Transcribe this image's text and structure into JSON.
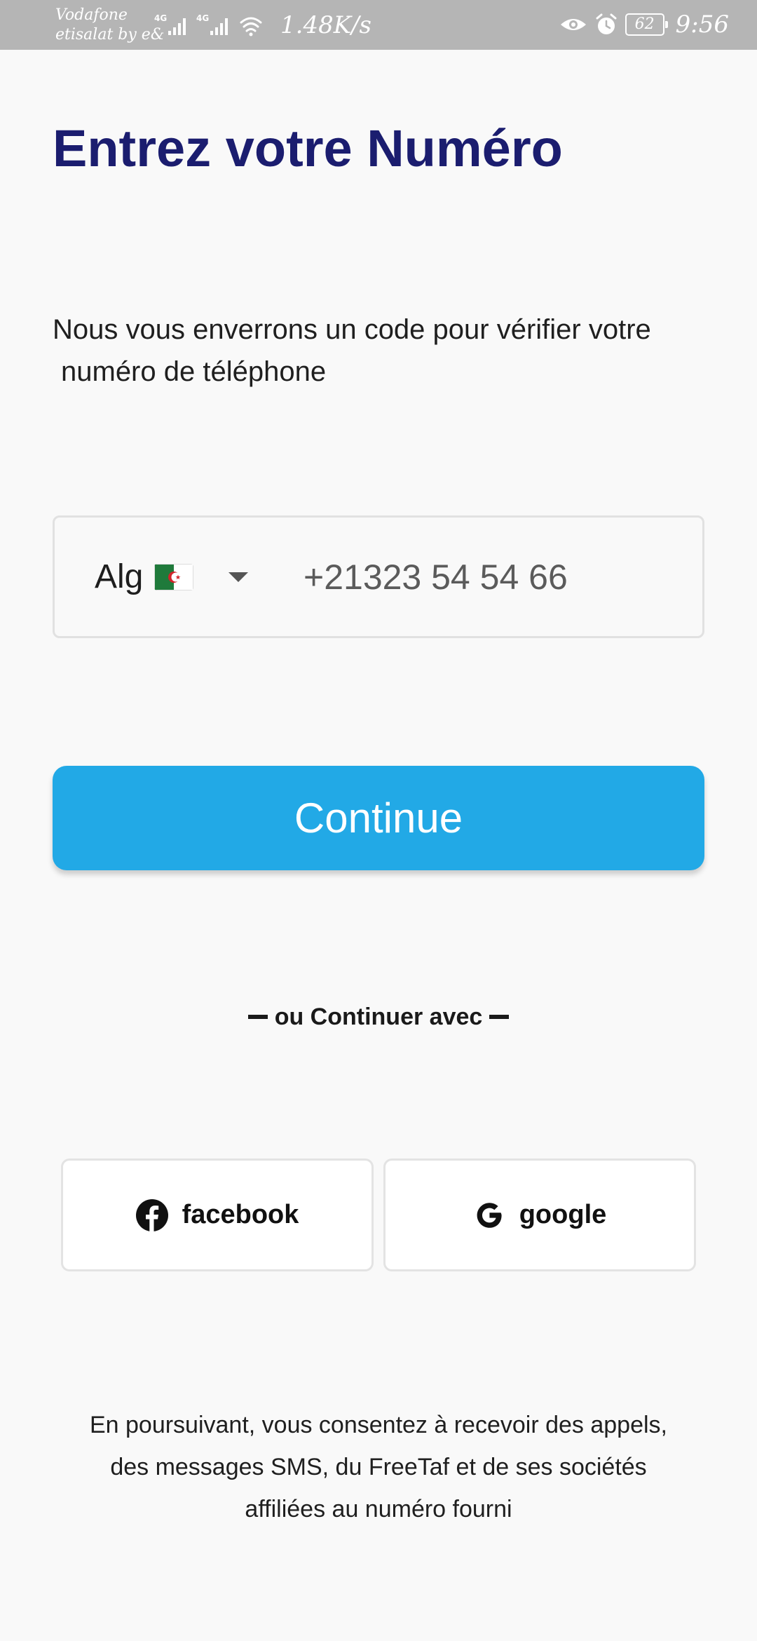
{
  "status_bar": {
    "carrier_line1": "Vodafone",
    "carrier_line2": "etisalat by e&",
    "network_type_1": "4G",
    "network_type_2": "4G",
    "net_speed": "1.48K/s",
    "battery": "62",
    "time": "9:56",
    "icons": [
      "signal-icon",
      "signal-icon",
      "wifi-icon",
      "eye-icon",
      "alarm-icon",
      "battery-icon"
    ]
  },
  "header": {
    "title": "Entrez votre Numéro"
  },
  "subtitle": {
    "line1": "Nous vous enverrons un code pour vérifier votre",
    "line2": "numéro de téléphone"
  },
  "phone_form": {
    "country_code": "Alg",
    "flag": "algeria-flag-icon",
    "dropdown_icon": "caret-down-icon",
    "phone_placeholder": "+21323 54 54 66",
    "phone_value": ""
  },
  "continue_button": {
    "label": "Continue",
    "color": "#22a9e6"
  },
  "divider": {
    "text": "ou Continuer avec"
  },
  "social": {
    "facebook_label": "facebook",
    "google_label": "google"
  },
  "legal": {
    "line1": "En poursuivant, vous consentez à recevoir des appels,",
    "line2": "des messages SMS, du FreeTaf et de ses sociétés",
    "line3": "affiliées au numéro fourni"
  },
  "colors": {
    "title": "#1b1d6f",
    "accent": "#22a9e6",
    "background": "#f9f9f9",
    "status_bar": "#b5b5b5"
  }
}
